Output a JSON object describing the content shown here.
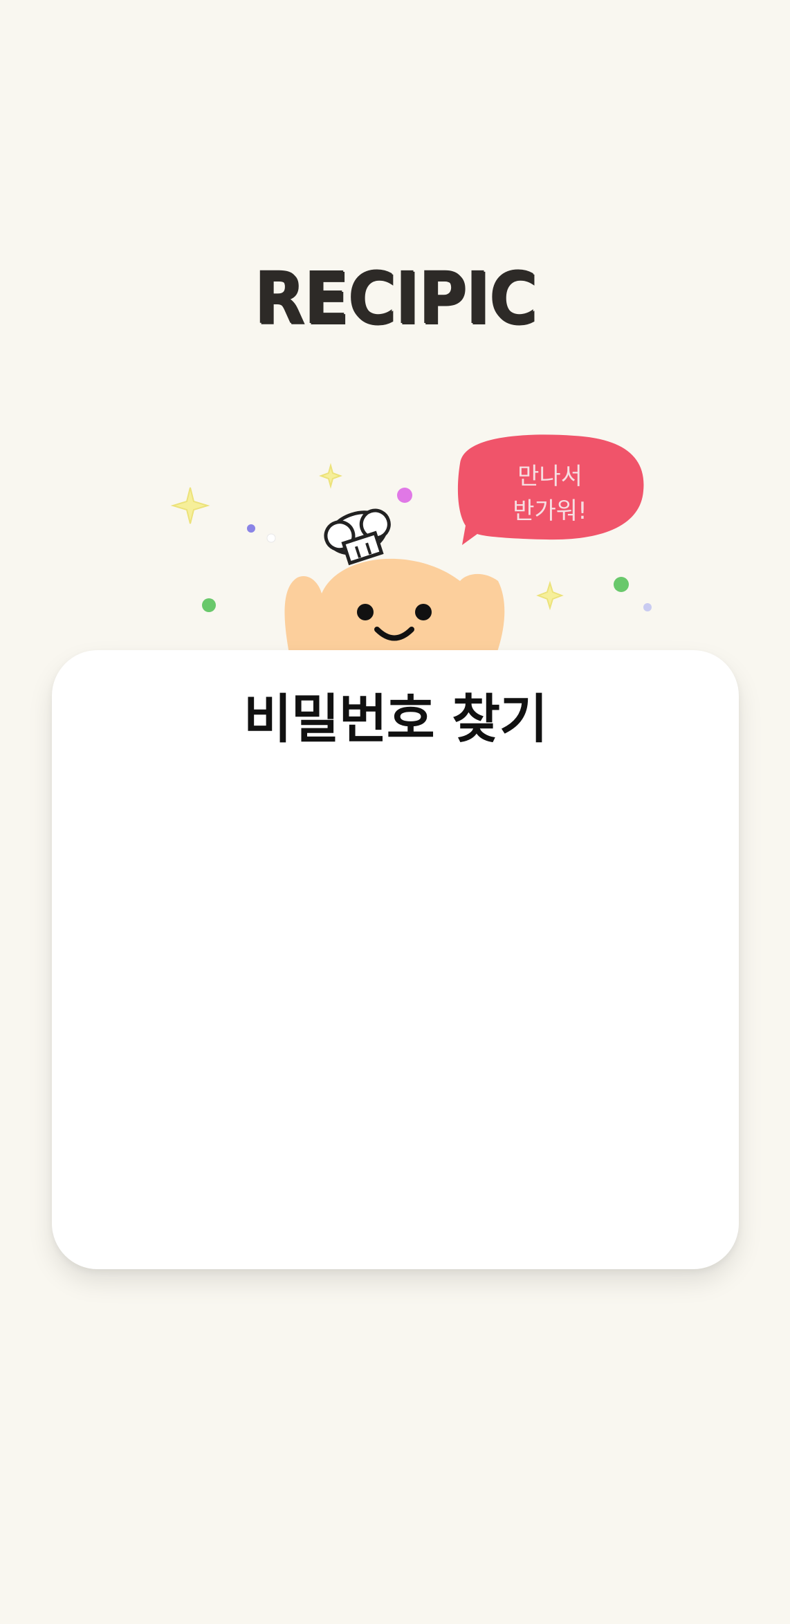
{
  "app": {
    "logo_text": "RECIPIC"
  },
  "mascot": {
    "speech_bubble_line1": "만나서",
    "speech_bubble_line2": "반가워!",
    "icon": "chef-mascot-icon"
  },
  "card": {
    "title": "비밀번호 찾기"
  },
  "colors": {
    "background": "#f9f7f0",
    "card": "#ffffff",
    "bubble": "#f0546a",
    "mascot_body": "#fccf9c",
    "logo": "#2d2a27"
  }
}
